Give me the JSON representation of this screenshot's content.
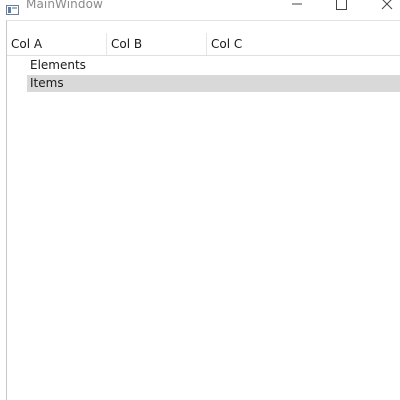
{
  "window": {
    "title": "MainWindow",
    "controls": {
      "minimize_icon": "minimize-icon",
      "maximize_icon": "maximize-icon",
      "close_icon": "close-icon"
    }
  },
  "tree": {
    "columns": [
      "Col A",
      "Col B",
      "Col C"
    ],
    "items": [
      {
        "label": "Elements",
        "selected": false
      },
      {
        "label": "Items",
        "selected": true
      }
    ]
  },
  "colors": {
    "selection": "#d9d9d9",
    "title_text": "#8a8a8a"
  }
}
